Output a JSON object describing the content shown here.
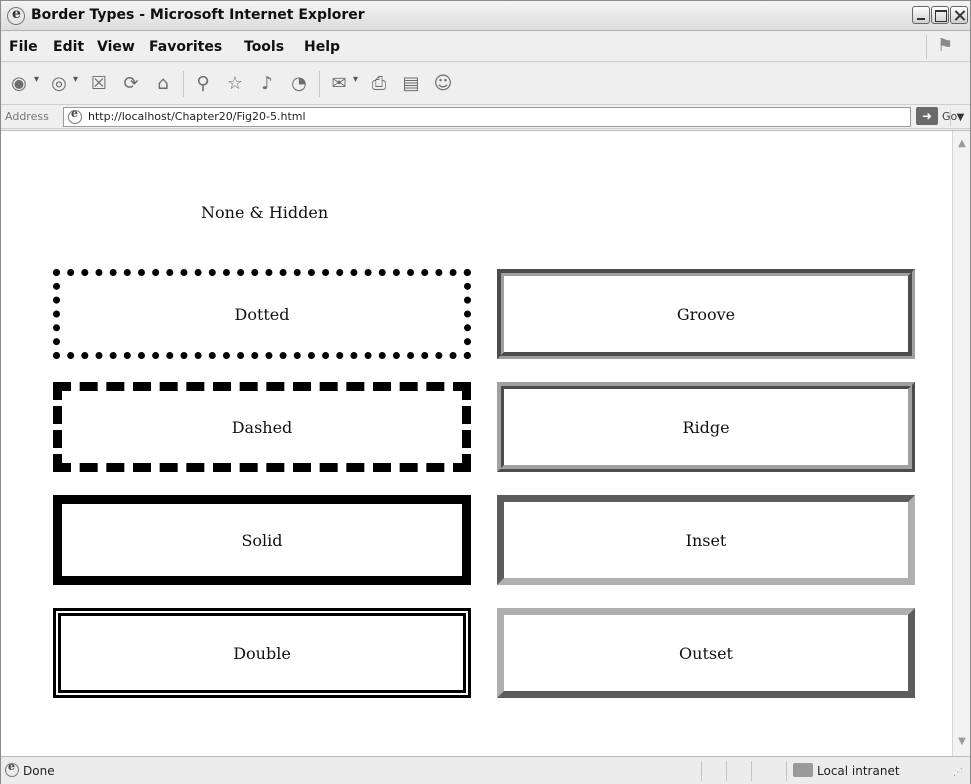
{
  "window": {
    "title": "Border Types - Microsoft Internet Explorer"
  },
  "menubar": {
    "items": [
      "File",
      "Edit",
      "View",
      "Favorites",
      "Tools",
      "Help"
    ]
  },
  "toolbar": {
    "icons": [
      "back-icon",
      "forward-icon",
      "stop-icon",
      "refresh-icon",
      "home-icon",
      "search-icon",
      "favorites-icon",
      "media-icon",
      "history-icon",
      "mail-icon",
      "print-icon",
      "edit-icon",
      "messenger-icon"
    ]
  },
  "addressbar": {
    "label": "Address",
    "url": "http://localhost/Chapter20/Fig20-5.html",
    "go_label": "Go"
  },
  "page": {
    "none_hidden": "None & Hidden",
    "boxes": {
      "dotted": "Dotted",
      "groove": "Groove",
      "dashed": "Dashed",
      "ridge": "Ridge",
      "solid": "Solid",
      "inset": "Inset",
      "double": "Double",
      "outset": "Outset"
    }
  },
  "statusbar": {
    "status": "Done",
    "zone": "Local intranet"
  }
}
